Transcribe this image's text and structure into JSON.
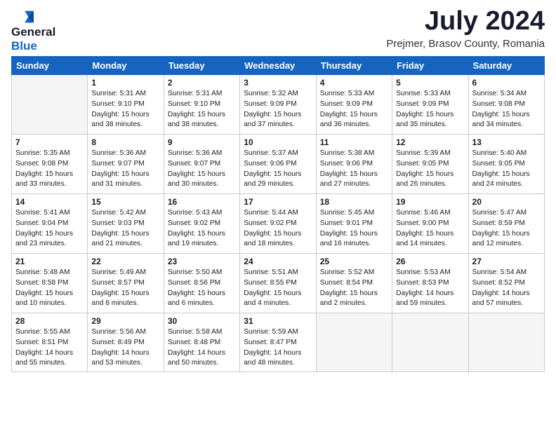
{
  "header": {
    "logo_line1": "General",
    "logo_line2": "Blue",
    "month": "July 2024",
    "location": "Prejmer, Brasov County, Romania"
  },
  "days_of_week": [
    "Sunday",
    "Monday",
    "Tuesday",
    "Wednesday",
    "Thursday",
    "Friday",
    "Saturday"
  ],
  "weeks": [
    [
      {
        "day": "",
        "info": ""
      },
      {
        "day": "1",
        "info": "Sunrise: 5:31 AM\nSunset: 9:10 PM\nDaylight: 15 hours\nand 38 minutes."
      },
      {
        "day": "2",
        "info": "Sunrise: 5:31 AM\nSunset: 9:10 PM\nDaylight: 15 hours\nand 38 minutes."
      },
      {
        "day": "3",
        "info": "Sunrise: 5:32 AM\nSunset: 9:09 PM\nDaylight: 15 hours\nand 37 minutes."
      },
      {
        "day": "4",
        "info": "Sunrise: 5:33 AM\nSunset: 9:09 PM\nDaylight: 15 hours\nand 36 minutes."
      },
      {
        "day": "5",
        "info": "Sunrise: 5:33 AM\nSunset: 9:09 PM\nDaylight: 15 hours\nand 35 minutes."
      },
      {
        "day": "6",
        "info": "Sunrise: 5:34 AM\nSunset: 9:08 PM\nDaylight: 15 hours\nand 34 minutes."
      }
    ],
    [
      {
        "day": "7",
        "info": "Sunrise: 5:35 AM\nSunset: 9:08 PM\nDaylight: 15 hours\nand 33 minutes."
      },
      {
        "day": "8",
        "info": "Sunrise: 5:36 AM\nSunset: 9:07 PM\nDaylight: 15 hours\nand 31 minutes."
      },
      {
        "day": "9",
        "info": "Sunrise: 5:36 AM\nSunset: 9:07 PM\nDaylight: 15 hours\nand 30 minutes."
      },
      {
        "day": "10",
        "info": "Sunrise: 5:37 AM\nSunset: 9:06 PM\nDaylight: 15 hours\nand 29 minutes."
      },
      {
        "day": "11",
        "info": "Sunrise: 5:38 AM\nSunset: 9:06 PM\nDaylight: 15 hours\nand 27 minutes."
      },
      {
        "day": "12",
        "info": "Sunrise: 5:39 AM\nSunset: 9:05 PM\nDaylight: 15 hours\nand 26 minutes."
      },
      {
        "day": "13",
        "info": "Sunrise: 5:40 AM\nSunset: 9:05 PM\nDaylight: 15 hours\nand 24 minutes."
      }
    ],
    [
      {
        "day": "14",
        "info": "Sunrise: 5:41 AM\nSunset: 9:04 PM\nDaylight: 15 hours\nand 23 minutes."
      },
      {
        "day": "15",
        "info": "Sunrise: 5:42 AM\nSunset: 9:03 PM\nDaylight: 15 hours\nand 21 minutes."
      },
      {
        "day": "16",
        "info": "Sunrise: 5:43 AM\nSunset: 9:02 PM\nDaylight: 15 hours\nand 19 minutes."
      },
      {
        "day": "17",
        "info": "Sunrise: 5:44 AM\nSunset: 9:02 PM\nDaylight: 15 hours\nand 18 minutes."
      },
      {
        "day": "18",
        "info": "Sunrise: 5:45 AM\nSunset: 9:01 PM\nDaylight: 15 hours\nand 16 minutes."
      },
      {
        "day": "19",
        "info": "Sunrise: 5:46 AM\nSunset: 9:00 PM\nDaylight: 15 hours\nand 14 minutes."
      },
      {
        "day": "20",
        "info": "Sunrise: 5:47 AM\nSunset: 8:59 PM\nDaylight: 15 hours\nand 12 minutes."
      }
    ],
    [
      {
        "day": "21",
        "info": "Sunrise: 5:48 AM\nSunset: 8:58 PM\nDaylight: 15 hours\nand 10 minutes."
      },
      {
        "day": "22",
        "info": "Sunrise: 5:49 AM\nSunset: 8:57 PM\nDaylight: 15 hours\nand 8 minutes."
      },
      {
        "day": "23",
        "info": "Sunrise: 5:50 AM\nSunset: 8:56 PM\nDaylight: 15 hours\nand 6 minutes."
      },
      {
        "day": "24",
        "info": "Sunrise: 5:51 AM\nSunset: 8:55 PM\nDaylight: 15 hours\nand 4 minutes."
      },
      {
        "day": "25",
        "info": "Sunrise: 5:52 AM\nSunset: 8:54 PM\nDaylight: 15 hours\nand 2 minutes."
      },
      {
        "day": "26",
        "info": "Sunrise: 5:53 AM\nSunset: 8:53 PM\nDaylight: 14 hours\nand 59 minutes."
      },
      {
        "day": "27",
        "info": "Sunrise: 5:54 AM\nSunset: 8:52 PM\nDaylight: 14 hours\nand 57 minutes."
      }
    ],
    [
      {
        "day": "28",
        "info": "Sunrise: 5:55 AM\nSunset: 8:51 PM\nDaylight: 14 hours\nand 55 minutes."
      },
      {
        "day": "29",
        "info": "Sunrise: 5:56 AM\nSunset: 8:49 PM\nDaylight: 14 hours\nand 53 minutes."
      },
      {
        "day": "30",
        "info": "Sunrise: 5:58 AM\nSunset: 8:48 PM\nDaylight: 14 hours\nand 50 minutes."
      },
      {
        "day": "31",
        "info": "Sunrise: 5:59 AM\nSunset: 8:47 PM\nDaylight: 14 hours\nand 48 minutes."
      },
      {
        "day": "",
        "info": ""
      },
      {
        "day": "",
        "info": ""
      },
      {
        "day": "",
        "info": ""
      }
    ]
  ]
}
